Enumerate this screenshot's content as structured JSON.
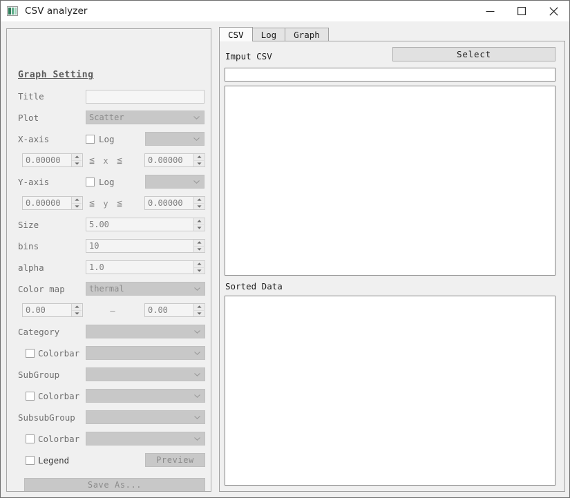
{
  "window": {
    "title": "CSV analyzer",
    "icon": "app-chart-icon",
    "controls": {
      "minimize": "minimize-icon",
      "maximize": "maximize-icon",
      "close": "close-icon"
    }
  },
  "left_panel": {
    "heading": "Graph Setting",
    "title_row": {
      "label": "Title",
      "value": ""
    },
    "plot_row": {
      "label": "Plot",
      "value": "Scatter"
    },
    "x_axis": {
      "label": "X-axis",
      "log_label": "Log",
      "log_checked": false,
      "column": "",
      "min": "0.00000",
      "max": "0.00000",
      "op_left": "≦",
      "var": "x",
      "op_right": "≦"
    },
    "y_axis": {
      "label": "Y-axis",
      "log_label": "Log",
      "log_checked": false,
      "column": "",
      "min": "0.00000",
      "max": "0.00000",
      "op_left": "≦",
      "var": "y",
      "op_right": "≦"
    },
    "size_row": {
      "label": "Size",
      "value": "5.00"
    },
    "bins_row": {
      "label": "bins",
      "value": "10"
    },
    "alpha_row": {
      "label": "alpha",
      "value": "1.0"
    },
    "colormap_row": {
      "label": "Color map",
      "value": "thermal"
    },
    "colormap_range": {
      "min": "0.00",
      "max": "0.00",
      "separator": "—"
    },
    "category_row": {
      "label": "Category",
      "value": ""
    },
    "category_colorbar": {
      "label": "Colorbar",
      "checked": false,
      "value": ""
    },
    "subgroup_row": {
      "label": "SubGroup",
      "value": ""
    },
    "subgroup_colorbar": {
      "label": "Colorbar",
      "checked": false,
      "value": ""
    },
    "subsubgroup_row": {
      "label": "SubsubGroup",
      "value": ""
    },
    "subsubgroup_colorbar": {
      "label": "Colorbar",
      "checked": false,
      "value": ""
    },
    "legend": {
      "label": "Legend",
      "checked": false
    },
    "preview_button": "Preview",
    "save_button": "Save As..."
  },
  "right_panel": {
    "tabs": [
      {
        "label": "CSV",
        "active": true
      },
      {
        "label": "Log",
        "active": false
      },
      {
        "label": "Graph",
        "active": false
      }
    ],
    "input_csv_label": "Imput CSV",
    "select_button": "Select",
    "path_value": "",
    "preview_text": "",
    "sorted_data_label": "Sorted Data",
    "sorted_data_text": ""
  },
  "colors": {
    "window_bg": "#f0f0f0",
    "titlebar_bg": "#ffffff",
    "disabled_control": "#c8c8c8",
    "disabled_text": "#8b8b8b",
    "label_text": "#6f6f6f",
    "active_tab_bg": "#fbfbfb",
    "inactive_tab_bg": "#e4e4e4",
    "field_bg": "#ffffff",
    "icon_accent": "#2f7d5a"
  }
}
